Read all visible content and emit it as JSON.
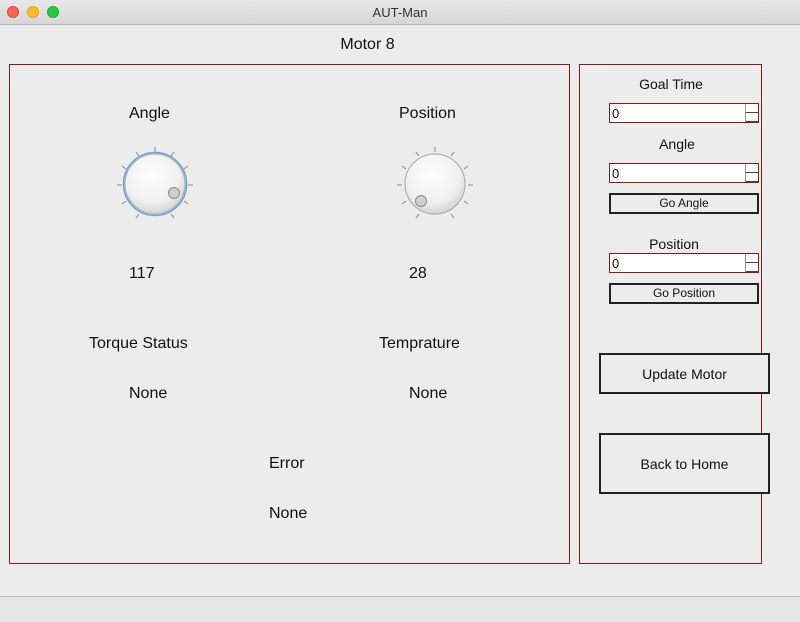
{
  "window": {
    "title": "AUT-Man"
  },
  "header": {
    "title": "Motor 8"
  },
  "main": {
    "angle": {
      "label": "Angle",
      "value": "117"
    },
    "position": {
      "label": "Position",
      "value": "28"
    },
    "torque": {
      "label": "Torque Status",
      "value": "None"
    },
    "temperature": {
      "label": "Temprature",
      "value": "None"
    },
    "error": {
      "label": "Error",
      "value": "None"
    }
  },
  "side": {
    "goal_time": {
      "label": "Goal Time",
      "value": "0"
    },
    "angle": {
      "label": "Angle",
      "value": "0",
      "button": "Go Angle"
    },
    "position": {
      "label": "Position",
      "value": "0",
      "button": "Go Position"
    },
    "update_button": "Update Motor",
    "home_button": "Back to Home"
  },
  "icons": {
    "close": "close-icon",
    "minimize": "minimize-icon",
    "maximize": "maximize-icon"
  },
  "colors": {
    "panel_border": "#8b1a1a",
    "focus_ring": "#6aa0d8",
    "background": "#ececec"
  }
}
